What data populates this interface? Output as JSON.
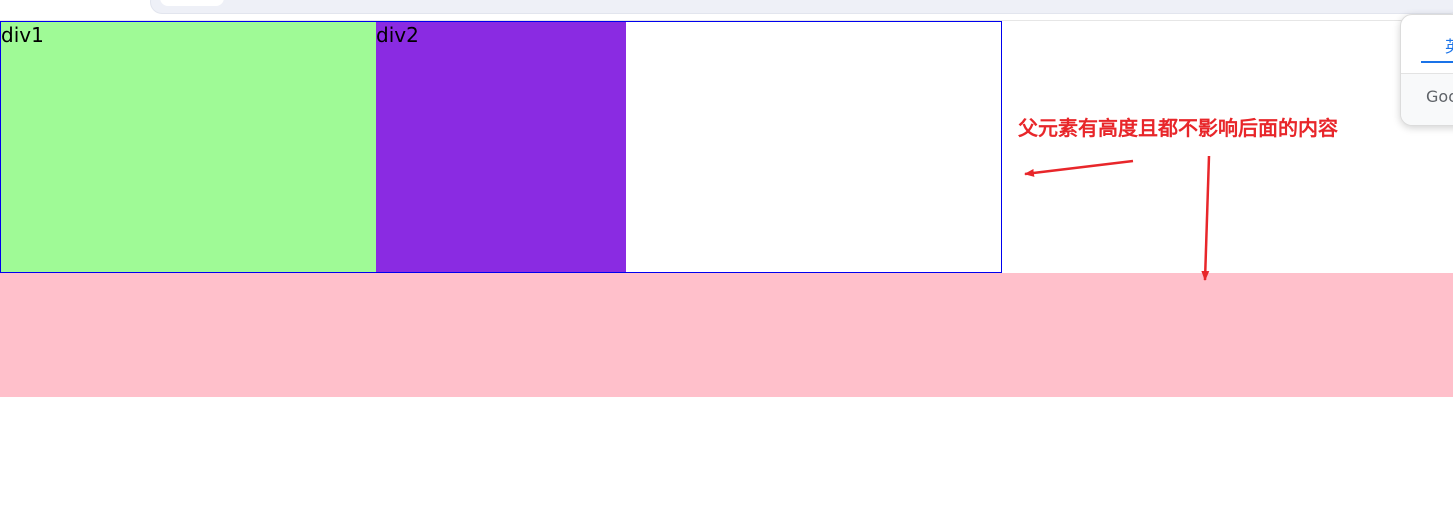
{
  "boxes": {
    "div1_label": "div1",
    "div2_label": "div2"
  },
  "annotation": {
    "text": "父元素有高度且都不影响后面的内容"
  },
  "popup": {
    "tab_label": "英",
    "footer_text": "Goo"
  },
  "colors": {
    "div1": "#9ffa96",
    "div2": "#8a2be2",
    "pink_block": "#ffc0cb",
    "parent_border": "#0000ee",
    "annotation": "#e8262a",
    "popup_accent": "#1a73e8"
  },
  "icons": {
    "annotation_arrows": [
      "arrow-left-icon",
      "arrow-down-icon"
    ]
  }
}
